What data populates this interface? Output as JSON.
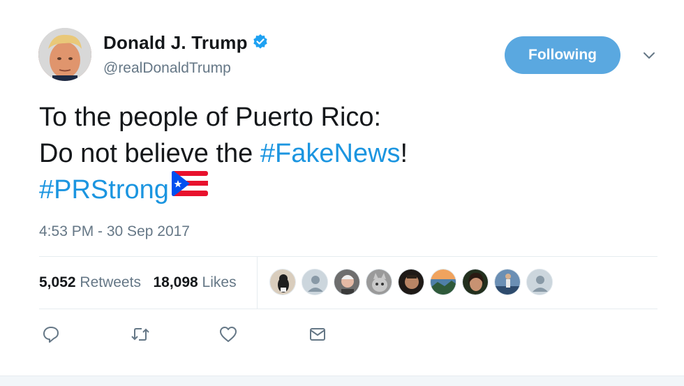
{
  "user": {
    "name": "Donald J. Trump",
    "handle": "@realDonaldTrump",
    "verified": true
  },
  "follow_button": {
    "label": "Following",
    "color": "#5aa8e0"
  },
  "tweet": {
    "line1": "To the people of Puerto Rico:",
    "line2_prefix": "Do not believe the ",
    "hashtag1": "#FakeNews",
    "line2_suffix": "!",
    "hashtag2": "#PRStrong",
    "emoji": "puerto-rico-flag"
  },
  "timestamp": "4:53 PM - 30 Sep 2017",
  "stats": {
    "retweets_count": "5,052",
    "retweets_label": "Retweets",
    "likes_count": "18,098",
    "likes_label": "Likes"
  },
  "liker_avatars": [
    "dog-photo",
    "default-profile",
    "person-photo",
    "cat-photo",
    "person-photo",
    "landscape-photo",
    "person-photo",
    "figure-photo",
    "default-profile"
  ],
  "actions": [
    "reply-icon",
    "retweet-icon",
    "like-icon",
    "direct-message-icon"
  ],
  "colors": {
    "link": "#1b95e0",
    "muted": "#657786",
    "text": "#14171a"
  }
}
